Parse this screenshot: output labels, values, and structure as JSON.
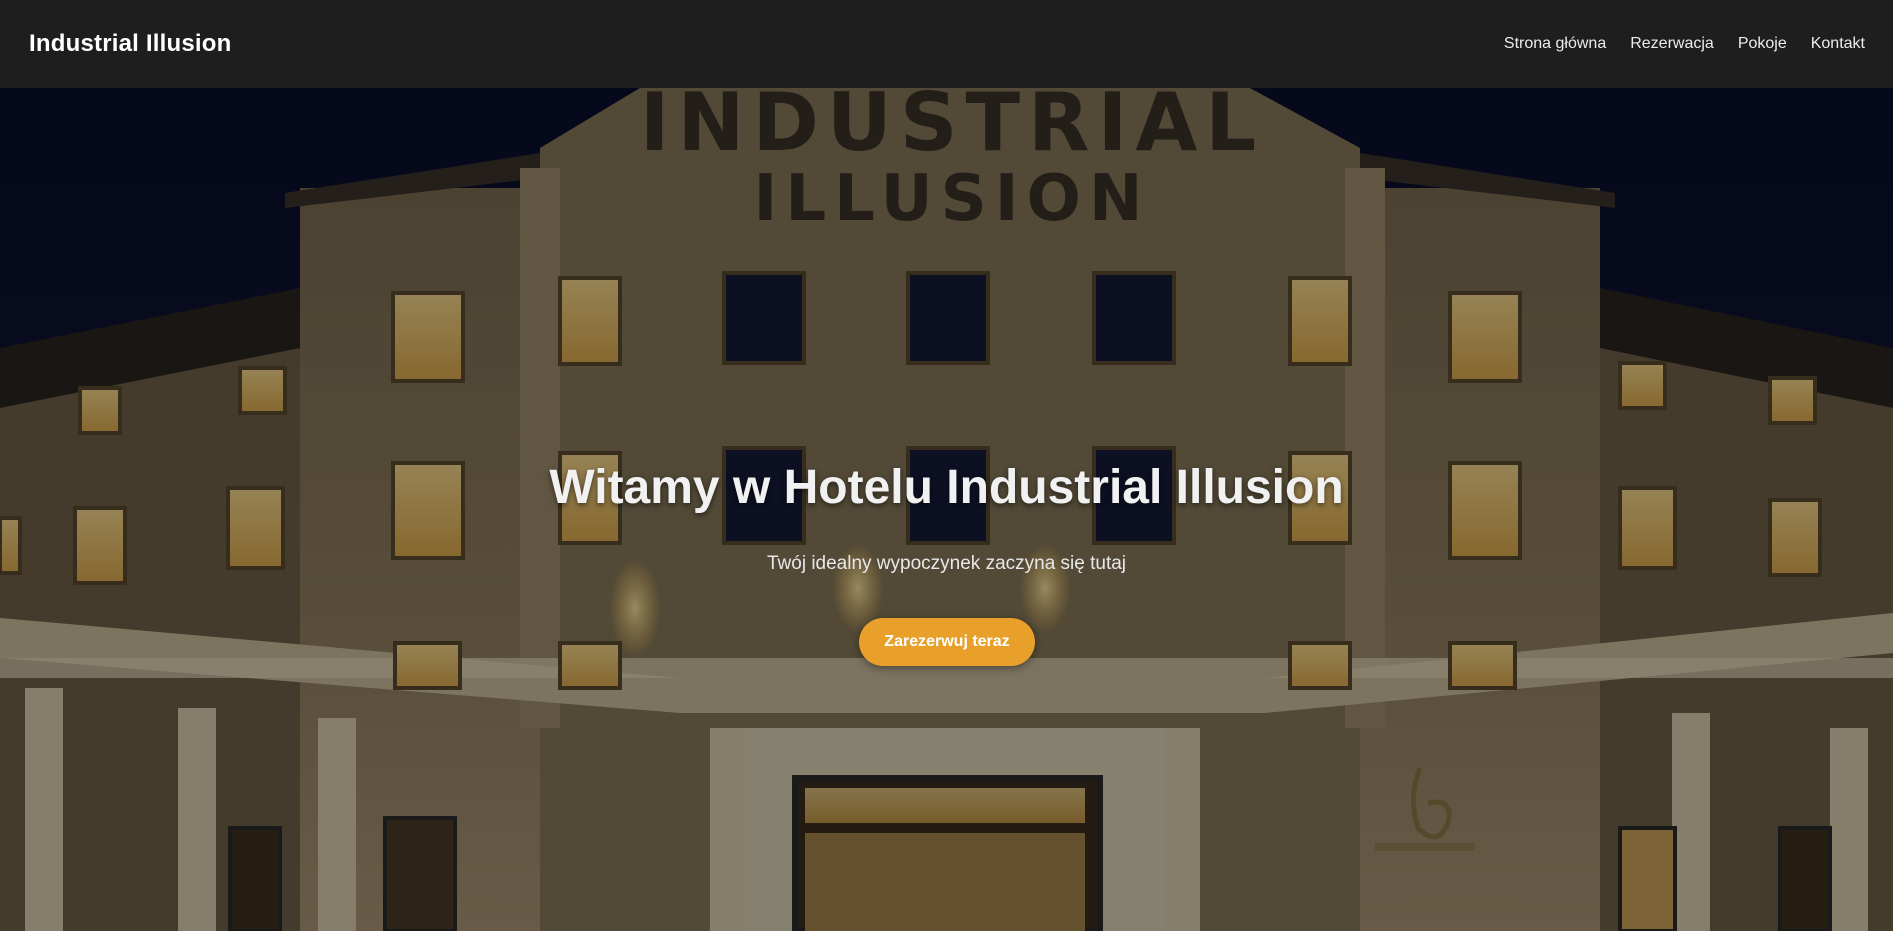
{
  "nav": {
    "brand": "Industrial Illusion",
    "links": [
      "Strona główna",
      "Rezerwacja",
      "Pokoje",
      "Kontakt"
    ]
  },
  "hero": {
    "facade_sign_line1": "INDUSTRIAL",
    "facade_sign_line2": "ILLUSION",
    "title": "Witamy w Hotelu Industrial Illusion",
    "subtitle": "Twój idealny wypoczynek zaczyna się tutaj",
    "cta_label": "Zarezerwuj teraz"
  },
  "colors": {
    "navbar": "#1e1e1e",
    "accent": "#e8a02a",
    "sky": "#0c1130",
    "facade": "#8a7a5c"
  }
}
